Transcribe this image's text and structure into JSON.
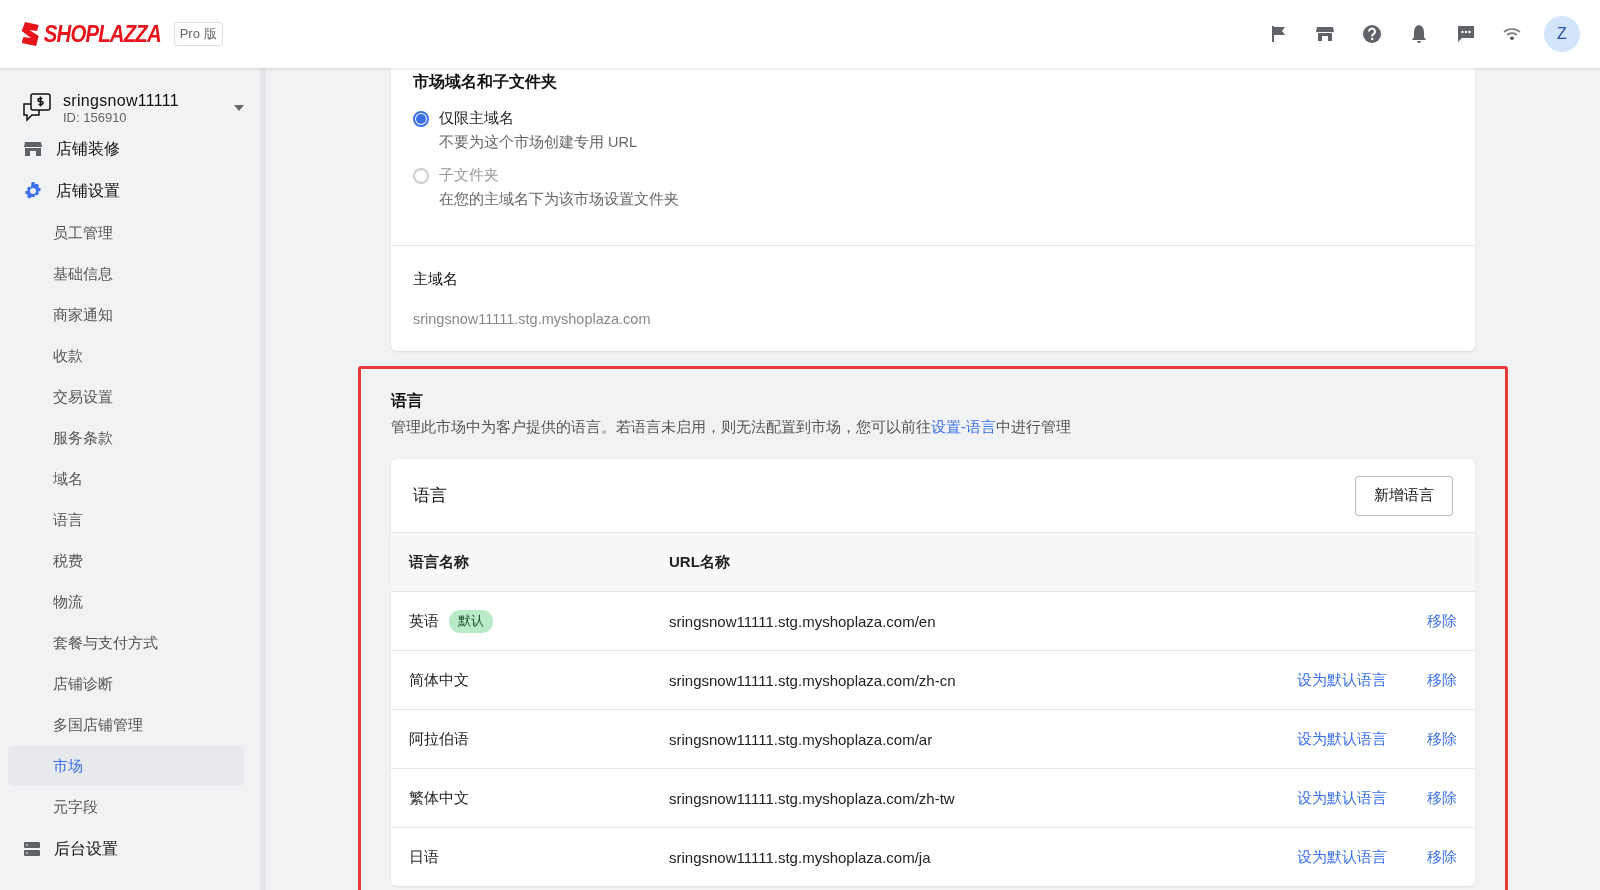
{
  "header": {
    "logo": "SHOPLAZZA",
    "plan_badge": "Pro 版",
    "avatar": "Z"
  },
  "sidebar": {
    "shop_name": "sringsnow11111",
    "shop_id": "ID: 156910",
    "items": [
      {
        "label": "店铺装修",
        "kind": "store",
        "expanded": false
      },
      {
        "label": "店铺设置",
        "kind": "gear",
        "expanded": true,
        "children": [
          {
            "label": "员工管理",
            "selected": false
          },
          {
            "label": "基础信息",
            "selected": false
          },
          {
            "label": "商家通知",
            "selected": false
          },
          {
            "label": "收款",
            "selected": false
          },
          {
            "label": "交易设置",
            "selected": false
          },
          {
            "label": "服务条款",
            "selected": false
          },
          {
            "label": "域名",
            "selected": false
          },
          {
            "label": "语言",
            "selected": false
          },
          {
            "label": "税费",
            "selected": false
          },
          {
            "label": "物流",
            "selected": false
          },
          {
            "label": "套餐与支付方式",
            "selected": false
          },
          {
            "label": "店铺诊断",
            "selected": false
          },
          {
            "label": "多国店铺管理",
            "selected": false
          },
          {
            "label": "市场",
            "selected": true
          },
          {
            "label": "元字段",
            "selected": false
          }
        ]
      },
      {
        "label": "后台设置",
        "kind": "server",
        "expanded": false
      }
    ]
  },
  "domain_card": {
    "heading": "市场域名和子文件夹",
    "options": [
      {
        "label": "仅限主域名",
        "description": "不要为这个市场创建专用 URL",
        "selected": true,
        "disabled": false
      },
      {
        "label": "子文件夹",
        "description": "在您的主域名下为该市场设置文件夹",
        "selected": false,
        "disabled": true
      }
    ],
    "domain_label": "主域名",
    "domain_value": "sringsnow11111.stg.myshoplaza.com"
  },
  "language_section": {
    "highlighted": true,
    "title": "语言",
    "description": "管理此市场中为客户提供的语言。若语言未启用，则无法配置到市场，您可以前往",
    "link": "设置-语言",
    "description_end": "中进行管理",
    "card_title": "语言",
    "add_button": "新增语言",
    "columns": [
      "语言名称",
      "URL名称"
    ],
    "rows": [
      {
        "name": "英语",
        "badge": "默认",
        "url": "sringsnow11111.stg.myshoplaza.com/en",
        "actions": [
          "移除"
        ]
      },
      {
        "name": "简体中文",
        "url": "sringsnow11111.stg.myshoplaza.com/zh-cn",
        "actions": [
          "设为默认语言",
          "移除"
        ]
      },
      {
        "name": "阿拉伯语",
        "url": "sringsnow11111.stg.myshoplaza.com/ar",
        "actions": [
          "设为默认语言",
          "移除"
        ]
      },
      {
        "name": "繁体中文",
        "url": "sringsnow11111.stg.myshoplaza.com/zh-tw",
        "actions": [
          "设为默认语言",
          "移除"
        ]
      },
      {
        "name": "日语",
        "url": "sringsnow11111.stg.myshoplaza.com/ja",
        "actions": [
          "设为默认语言",
          "移除"
        ]
      }
    ]
  }
}
